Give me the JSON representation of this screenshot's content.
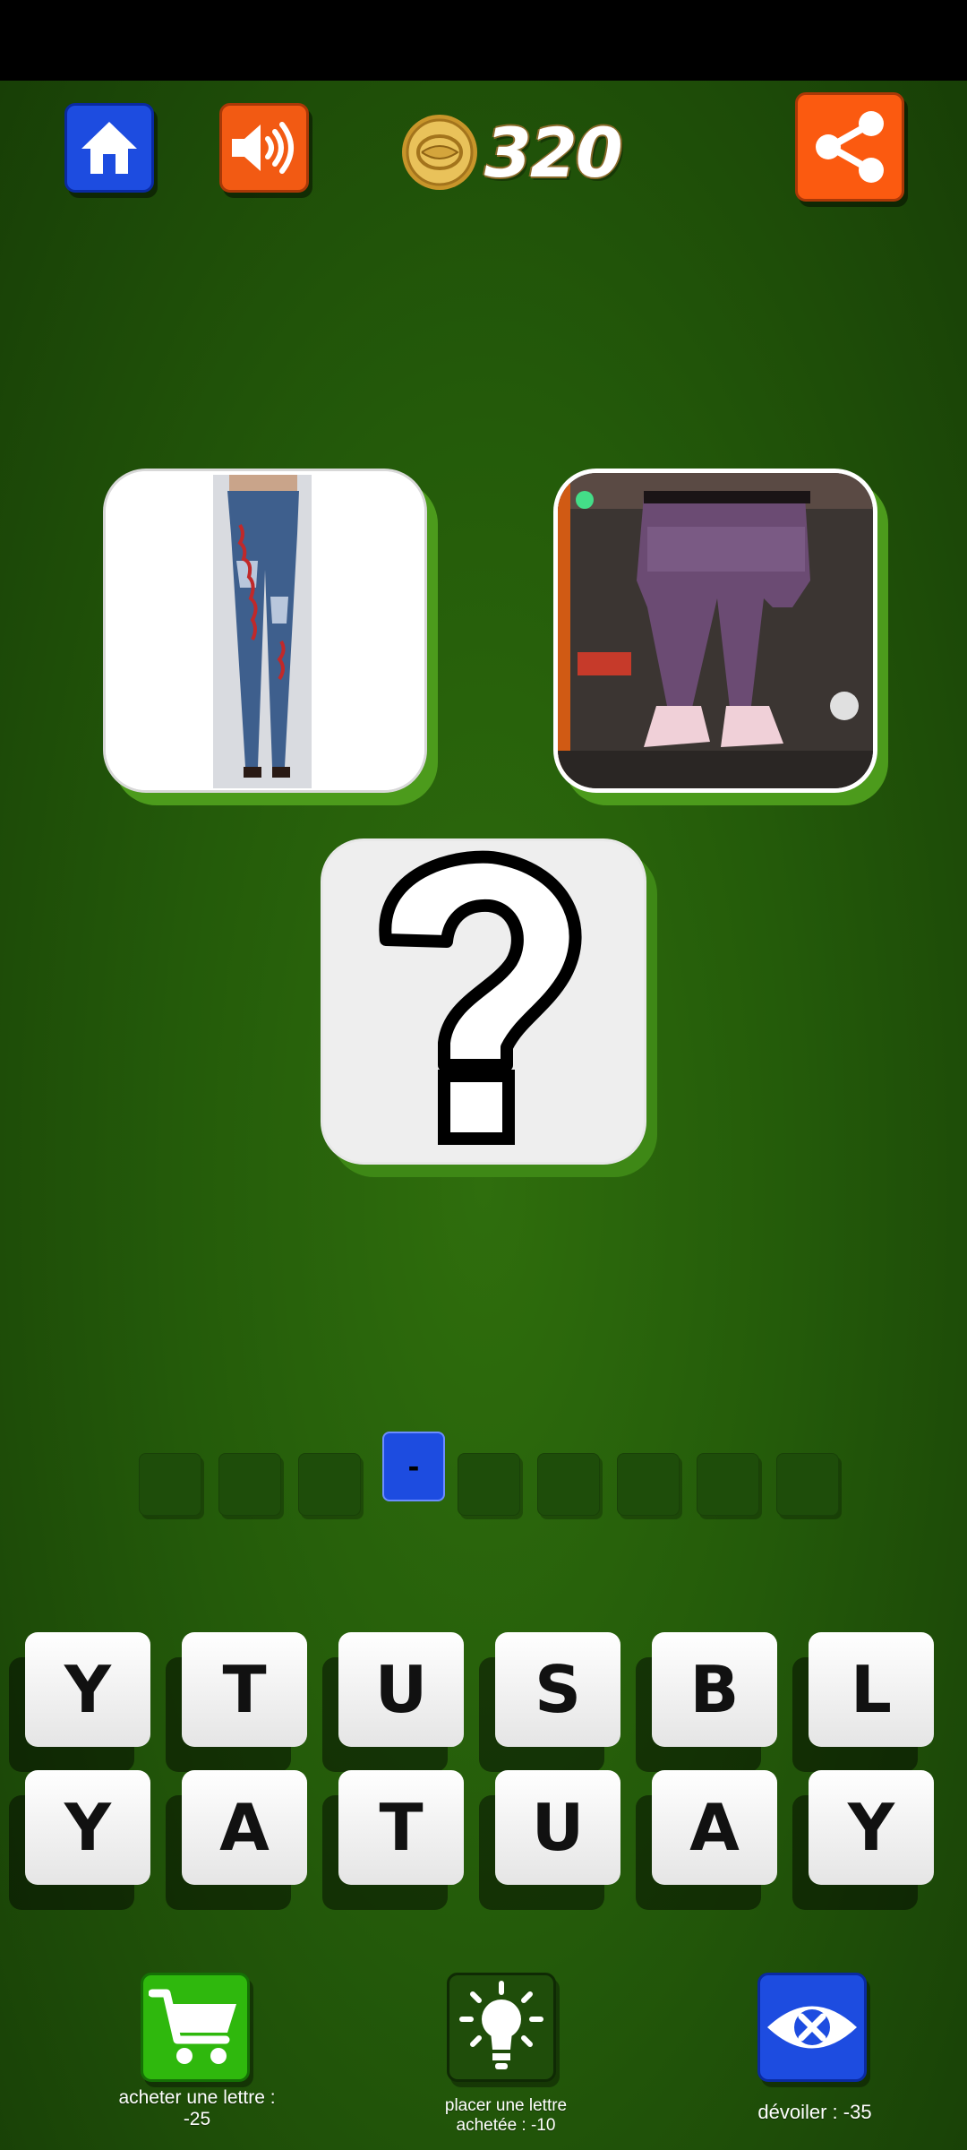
{
  "header": {
    "coins": "320",
    "home_icon": "home-icon",
    "sound_icon": "speaker-icon",
    "share_icon": "share-icon",
    "coin_icon": "coin-icon"
  },
  "puzzle": {
    "images": [
      {
        "name": "jeans-photo",
        "icon": "skinny-jeans-image"
      },
      {
        "name": "sagging-pants-photo",
        "icon": "baggy-pants-image"
      }
    ],
    "mystery": "question-mark-icon"
  },
  "answer": {
    "slots": [
      "",
      "",
      "",
      "-",
      "",
      "",
      "",
      "",
      ""
    ],
    "active_index": 3
  },
  "keyboard": {
    "row1": [
      "Y",
      "T",
      "U",
      "S",
      "B",
      "L"
    ],
    "row2": [
      "Y",
      "A",
      "T",
      "U",
      "A",
      "Y"
    ]
  },
  "actions": {
    "buy_label_line1": "acheter une lettre :",
    "buy_label_line2": "-25",
    "hint_label_line1": "placer une lettre",
    "hint_label_line2": "achetée : -10",
    "reveal_label": "dévoiler : -35"
  },
  "colors": {
    "background": "#245b0a",
    "home": "#1d4ce0",
    "sound": "#f25a13",
    "share": "#fb5a10",
    "buy": "#2fb80d",
    "hint": "#1f4d0a",
    "reveal": "#1d4ce0"
  }
}
